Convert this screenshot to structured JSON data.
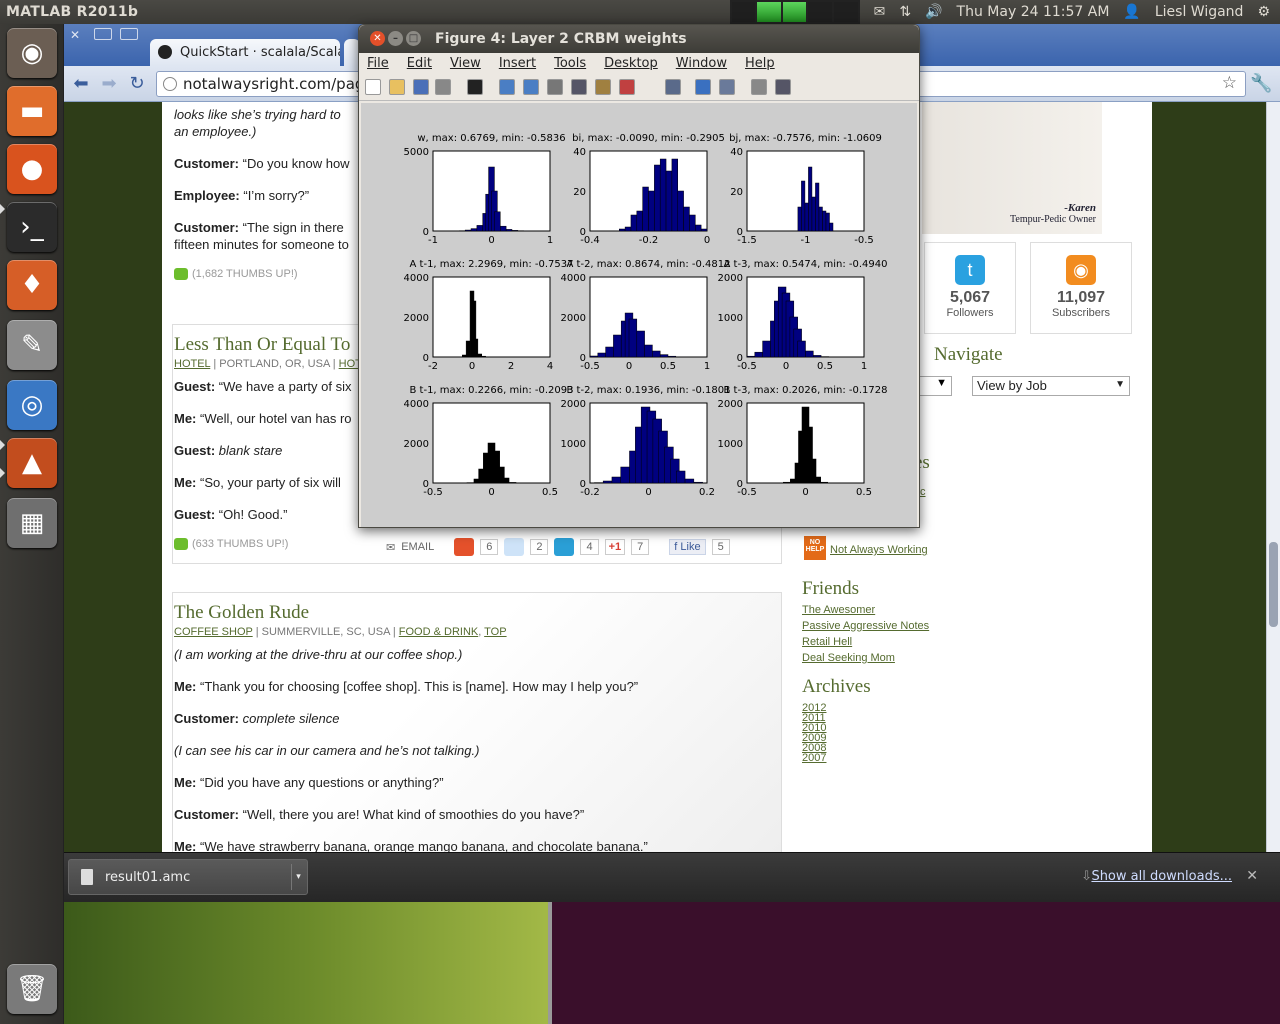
{
  "panel": {
    "app": "MATLAB  R2011b",
    "clock": "Thu May 24 11:57 AM",
    "user": "Liesl Wigand"
  },
  "launcher": [
    {
      "name": "ubuntu-dash-icon",
      "color": "#6b5e53",
      "glyph": "◉"
    },
    {
      "name": "files-icon",
      "color": "#e06d2c",
      "glyph": "▬"
    },
    {
      "name": "firefox-icon",
      "color": "#d9531e",
      "glyph": "●"
    },
    {
      "name": "terminal-icon",
      "color": "#2b2b2b",
      "glyph": "›_"
    },
    {
      "name": "software-center-icon",
      "color": "#d65e27",
      "glyph": "♦"
    },
    {
      "name": "text-editor-icon",
      "color": "#8c8c8c",
      "glyph": "✎"
    },
    {
      "name": "chromium-icon",
      "color": "#3a78c4",
      "glyph": "◎"
    },
    {
      "name": "matlab-icon",
      "color": "#c24d1e",
      "glyph": "▲"
    },
    {
      "name": "workspace-switcher-icon",
      "color": "#6f6f6f",
      "glyph": "▦"
    },
    {
      "name": "trash-icon",
      "color": "#7a7a7a",
      "glyph": "🗑"
    }
  ],
  "chrome": {
    "tab1": "QuickStart · scalala/Scalala",
    "url": "notalwaysright.com/page/11",
    "dl_file": "result01.amc",
    "dl_all": "Show all downloads..."
  },
  "post1": {
    "l1": "looks like she’s trying hard to",
    "l2": "an employee.)",
    "c1a": "Customer:",
    "c1b": " “Do you know how",
    "e1a": "Employee:",
    "e1b": " “I’m sorry?”",
    "c2a": "Customer:",
    "c2b": " “The sign in there",
    "c2c": "fifteen minutes for someone to",
    "thumbs": "(1,682 THUMBS UP!)"
  },
  "post2": {
    "title": "Less Than Or Equal To",
    "meta1": "HOTEL",
    "meta2": " | PORTLAND, OR, USA | ",
    "meta3": "HOT",
    "g1a": "Guest:",
    "g1b": " “We have a party of six",
    "m1a": "Me:",
    "m1b": " “Well, our hotel van has ro",
    "g2a": "Guest:",
    "g2b": " blank stare",
    "m2a": "Me:",
    "m2b": " “So, your party of six will",
    "g3a": "Guest:",
    "g3b": " “Oh! Good.”",
    "thumbs": "(633 THUMBS UP!)",
    "email": "EMAIL",
    "c_stumble": "6",
    "c_reddit": "2",
    "c_twitter": "4",
    "gplus": "+1",
    "c_gplus": "7",
    "like": "Like",
    "c_like": "5"
  },
  "post3": {
    "title": "The Golden Rude",
    "meta1": "COFFEE SHOP",
    "meta2": " | SUMMERVILLE, SC, USA | ",
    "meta3": "FOOD & DRINK",
    "meta4": "TOP",
    "p1": "(I am working at the drive-thru at our coffee shop.)",
    "p2a": "Me:",
    "p2b": " “Thank you for choosing [coffee shop]. This is [name]. How may I help you?”",
    "p3a": "Customer:",
    "p3b": " complete silence",
    "p4": "(I can see his car in our camera and he’s not talking.)",
    "p5a": "Me:",
    "p5b": " “Did you have any questions or anything?”",
    "p6a": "Customer:",
    "p6b": " “Well, there you are! What kind of smoothies do you have?”",
    "p7a": "Me:",
    "p7b": " “We have strawberry banana, orange mango banana, and chocolate banana.”"
  },
  "sidebar": {
    "ad_name": "-Karen",
    "ad_sub": "Tempur-Pedic Owner",
    "followers_n": "5,067",
    "followers": "Followers",
    "subs_n": "11,097",
    "subs": "Subscribers",
    "navigate": "Navigate",
    "viewbyjob": "View by Job",
    "naw": "Not Always Working",
    "friends": "Friends",
    "f1": "The Awesomer",
    "f2": "Passive Aggressive Notes",
    "f3": "Retail Hell",
    "f4": "Deal Seeking Mom",
    "archives": "Archives",
    "years": [
      "2012",
      "2011",
      "2010",
      "2009",
      "2008",
      "2007"
    ],
    "partial1": "es",
    "partial2": "c"
  },
  "figure": {
    "title": "Figure 4: Layer 2 CRBM weights",
    "menu": [
      "File",
      "Edit",
      "View",
      "Insert",
      "Tools",
      "Desktop",
      "Window",
      "Help"
    ]
  },
  "chart_data": [
    {
      "type": "bar",
      "title": "w, max: 0.6769, min: -0.5836",
      "xlim": [
        -1,
        1
      ],
      "ylim": [
        0,
        5000
      ],
      "xticks": [
        "-1",
        "0",
        "1"
      ],
      "yticks": [
        "0",
        "5000"
      ],
      "color": "#000080",
      "bins": [
        [
          -0.5,
          20
        ],
        [
          -0.4,
          60
        ],
        [
          -0.3,
          150
        ],
        [
          -0.2,
          350
        ],
        [
          -0.1,
          1100
        ],
        [
          -0.05,
          2300
        ],
        [
          0,
          4000
        ],
        [
          0.05,
          2500
        ],
        [
          0.1,
          1200
        ],
        [
          0.2,
          300
        ],
        [
          0.3,
          100
        ],
        [
          0.4,
          40
        ],
        [
          0.5,
          20
        ],
        [
          0.6,
          10
        ]
      ]
    },
    {
      "type": "bar",
      "title": "bi, max: -0.0090, min: -0.2905",
      "xlim": [
        -0.4,
        0
      ],
      "ylim": [
        0,
        40
      ],
      "xticks": [
        "-0.4",
        "-0.2",
        "0"
      ],
      "yticks": [
        "0",
        "20",
        "40"
      ],
      "color": "#000080",
      "bins": [
        [
          -0.29,
          1
        ],
        [
          -0.27,
          2
        ],
        [
          -0.25,
          8
        ],
        [
          -0.23,
          10
        ],
        [
          -0.21,
          22
        ],
        [
          -0.19,
          20
        ],
        [
          -0.17,
          33
        ],
        [
          -0.15,
          36
        ],
        [
          -0.13,
          30
        ],
        [
          -0.11,
          36
        ],
        [
          -0.09,
          20
        ],
        [
          -0.07,
          12
        ],
        [
          -0.05,
          8
        ],
        [
          -0.03,
          3
        ],
        [
          -0.01,
          1
        ]
      ]
    },
    {
      "type": "bar",
      "title": "bj, max: -0.7576, min: -1.0609",
      "xlim": [
        -1.5,
        -0.5
      ],
      "ylim": [
        0,
        40
      ],
      "xticks": [
        "-1.5",
        "-1",
        "-0.5"
      ],
      "yticks": [
        "0",
        "20",
        "40"
      ],
      "color": "#000080",
      "bins": [
        [
          -1.05,
          12
        ],
        [
          -1.02,
          25
        ],
        [
          -0.99,
          14
        ],
        [
          -0.96,
          32
        ],
        [
          -0.93,
          17
        ],
        [
          -0.9,
          24
        ],
        [
          -0.87,
          12
        ],
        [
          -0.84,
          10
        ],
        [
          -0.81,
          9
        ],
        [
          -0.78,
          4
        ]
      ]
    },
    {
      "type": "bar",
      "title": "A t-1, max: 2.2969, min: -0.7537",
      "xlim": [
        -2,
        4
      ],
      "ylim": [
        0,
        4000
      ],
      "xticks": [
        "-2",
        "0",
        "2",
        "4"
      ],
      "yticks": [
        "0",
        "2000",
        "4000"
      ],
      "color": "#000000",
      "bins": [
        [
          -0.6,
          10
        ],
        [
          -0.4,
          100
        ],
        [
          -0.2,
          800
        ],
        [
          0,
          3300
        ],
        [
          0.1,
          2800
        ],
        [
          0.2,
          900
        ],
        [
          0.4,
          150
        ],
        [
          0.6,
          40
        ],
        [
          0.8,
          10
        ]
      ]
    },
    {
      "type": "bar",
      "title": "A t-2, max: 0.8674, min: -0.4812",
      "xlim": [
        -0.5,
        1
      ],
      "ylim": [
        0,
        4000
      ],
      "xticks": [
        "-0.5",
        "0",
        "0.5",
        "1"
      ],
      "yticks": [
        "0",
        "2000",
        "4000"
      ],
      "color": "#000080",
      "bins": [
        [
          -0.45,
          50
        ],
        [
          -0.35,
          200
        ],
        [
          -0.25,
          500
        ],
        [
          -0.15,
          1100
        ],
        [
          -0.05,
          1800
        ],
        [
          0,
          2200
        ],
        [
          0.05,
          1900
        ],
        [
          0.15,
          1300
        ],
        [
          0.25,
          600
        ],
        [
          0.35,
          300
        ],
        [
          0.45,
          120
        ],
        [
          0.55,
          40
        ],
        [
          0.7,
          10
        ]
      ]
    },
    {
      "type": "bar",
      "title": "A t-3, max: 0.5474, min: -0.4940",
      "xlim": [
        -0.5,
        1
      ],
      "ylim": [
        0,
        2000
      ],
      "xticks": [
        "-0.5",
        "0",
        "0.5",
        "1"
      ],
      "yticks": [
        "0",
        "1000",
        "2000"
      ],
      "color": "#000080",
      "bins": [
        [
          -0.45,
          20
        ],
        [
          -0.35,
          120
        ],
        [
          -0.25,
          400
        ],
        [
          -0.15,
          900
        ],
        [
          -0.1,
          1400
        ],
        [
          -0.05,
          1750
        ],
        [
          0,
          1600
        ],
        [
          0.05,
          1400
        ],
        [
          0.1,
          1000
        ],
        [
          0.15,
          700
        ],
        [
          0.2,
          400
        ],
        [
          0.3,
          150
        ],
        [
          0.4,
          40
        ],
        [
          0.5,
          10
        ]
      ]
    },
    {
      "type": "bar",
      "title": "B t-1, max: 0.2266, min: -0.2093",
      "xlim": [
        -0.5,
        0.5
      ],
      "ylim": [
        0,
        4000
      ],
      "xticks": [
        "-0.5",
        "0",
        "0.5"
      ],
      "yticks": [
        "0",
        "2000",
        "4000"
      ],
      "color": "#000000",
      "bins": [
        [
          -0.18,
          20
        ],
        [
          -0.12,
          200
        ],
        [
          -0.08,
          700
        ],
        [
          -0.04,
          1500
        ],
        [
          0,
          2000
        ],
        [
          0.04,
          1600
        ],
        [
          0.08,
          800
        ],
        [
          0.12,
          250
        ],
        [
          0.18,
          30
        ]
      ]
    },
    {
      "type": "bar",
      "title": "B t-2, max: 0.1936, min: -0.1801",
      "xlim": [
        -0.2,
        0.2
      ],
      "ylim": [
        0,
        2000
      ],
      "xticks": [
        "-0.2",
        "0",
        "0.2"
      ],
      "yticks": [
        "0",
        "1000",
        "2000"
      ],
      "color": "#000080",
      "bins": [
        [
          -0.17,
          10
        ],
        [
          -0.14,
          50
        ],
        [
          -0.11,
          150
        ],
        [
          -0.08,
          400
        ],
        [
          -0.05,
          800
        ],
        [
          -0.03,
          1400
        ],
        [
          -0.01,
          1900
        ],
        [
          0.01,
          1800
        ],
        [
          0.03,
          1600
        ],
        [
          0.05,
          1300
        ],
        [
          0.07,
          900
        ],
        [
          0.09,
          600
        ],
        [
          0.11,
          300
        ],
        [
          0.14,
          100
        ],
        [
          0.17,
          20
        ]
      ]
    },
    {
      "type": "bar",
      "title": "B t-3, max: 0.2026, min: -0.1728",
      "xlim": [
        -0.5,
        0.5
      ],
      "ylim": [
        0,
        2000
      ],
      "xticks": [
        "-0.5",
        "0",
        "0.5"
      ],
      "yticks": [
        "0",
        "1000",
        "2000"
      ],
      "color": "#000000",
      "bins": [
        [
          -0.16,
          20
        ],
        [
          -0.1,
          100
        ],
        [
          -0.06,
          500
        ],
        [
          -0.03,
          1300
        ],
        [
          0,
          1900
        ],
        [
          0.03,
          1400
        ],
        [
          0.06,
          600
        ],
        [
          0.1,
          150
        ],
        [
          0.16,
          20
        ]
      ]
    }
  ]
}
